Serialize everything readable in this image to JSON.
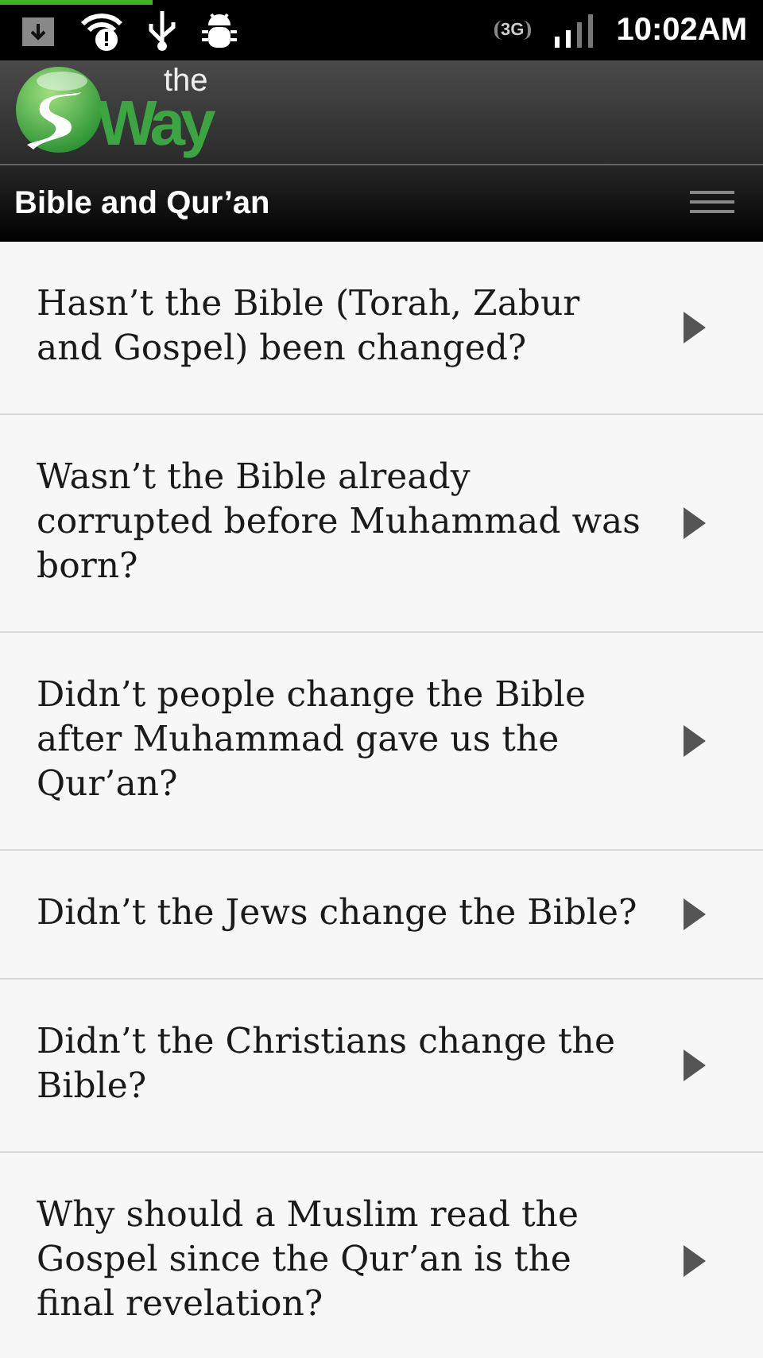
{
  "status_bar": {
    "network": "3G",
    "time": "10:02AM",
    "download_progress": {
      "level": 0.2
    }
  },
  "logo": {
    "small": "the",
    "large": "Way"
  },
  "title_bar": {
    "title": "Bible and Qur’an"
  },
  "questions": [
    {
      "text": "Hasn’t the Bible (Torah, Zabur and Gospel) been changed?"
    },
    {
      "text": "Wasn’t the Bible already corrupted before Muhammad was born?"
    },
    {
      "text": "Didn’t people change the Bible after Muhammad gave us the Qur’an?"
    },
    {
      "text": "Didn’t the Jews change the Bible?"
    },
    {
      "text": "Didn’t the Christians change the Bible?"
    },
    {
      "text": "Why should a Muslim read the Gospel since the Qur’an is the final revelation?"
    }
  ]
}
